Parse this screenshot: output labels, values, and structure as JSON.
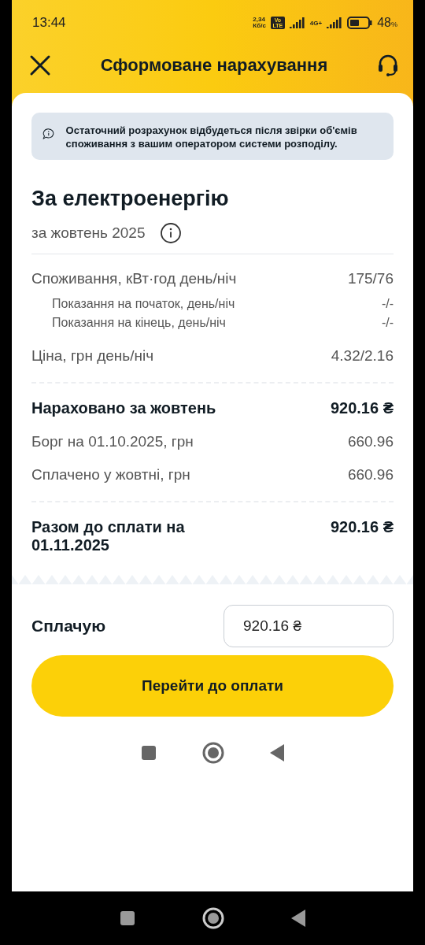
{
  "status_bar": {
    "time": "13:44",
    "speed": "2,34",
    "speed_unit": "Кб/с",
    "volte": "Vo LTE",
    "network": "4G+",
    "battery": "48",
    "battery_unit": "%"
  },
  "header": {
    "title": "Сформоване нарахування"
  },
  "notice": {
    "text": "Остаточний розрахунок відбудеться після звірки об'ємів споживання з вашим оператором системи розподілу."
  },
  "section": {
    "title": "За електроенергію",
    "period": "за жовтень 2025"
  },
  "rows": [
    {
      "kind": "main",
      "label": "Споживання, кВт·год день/ніч",
      "value": "175/76"
    },
    {
      "kind": "sub",
      "label": "Показання на початок, день/ніч",
      "value": "-/-"
    },
    {
      "kind": "sub",
      "label": "Показання на кінець, день/ніч",
      "value": "-/-"
    },
    {
      "kind": "main",
      "label": "Ціна, грн день/ніч",
      "value": "4.32/2.16"
    },
    {
      "kind": "divider"
    },
    {
      "kind": "bold",
      "label": "Нараховано за жовтень",
      "value": "920.16 ₴"
    },
    {
      "kind": "main",
      "label": "Борг на 01.10.2025, грн",
      "value": "660.96"
    },
    {
      "kind": "main",
      "label": "Сплачено у жовтні, грн",
      "value": "660.96"
    },
    {
      "kind": "divider"
    },
    {
      "kind": "bold",
      "label": "Разом до сплати на 01.11.2025",
      "value": "920.16 ₴"
    }
  ],
  "payment": {
    "label": "Сплачую",
    "amount": "920.16 ₴",
    "button": "Перейти до оплати"
  }
}
